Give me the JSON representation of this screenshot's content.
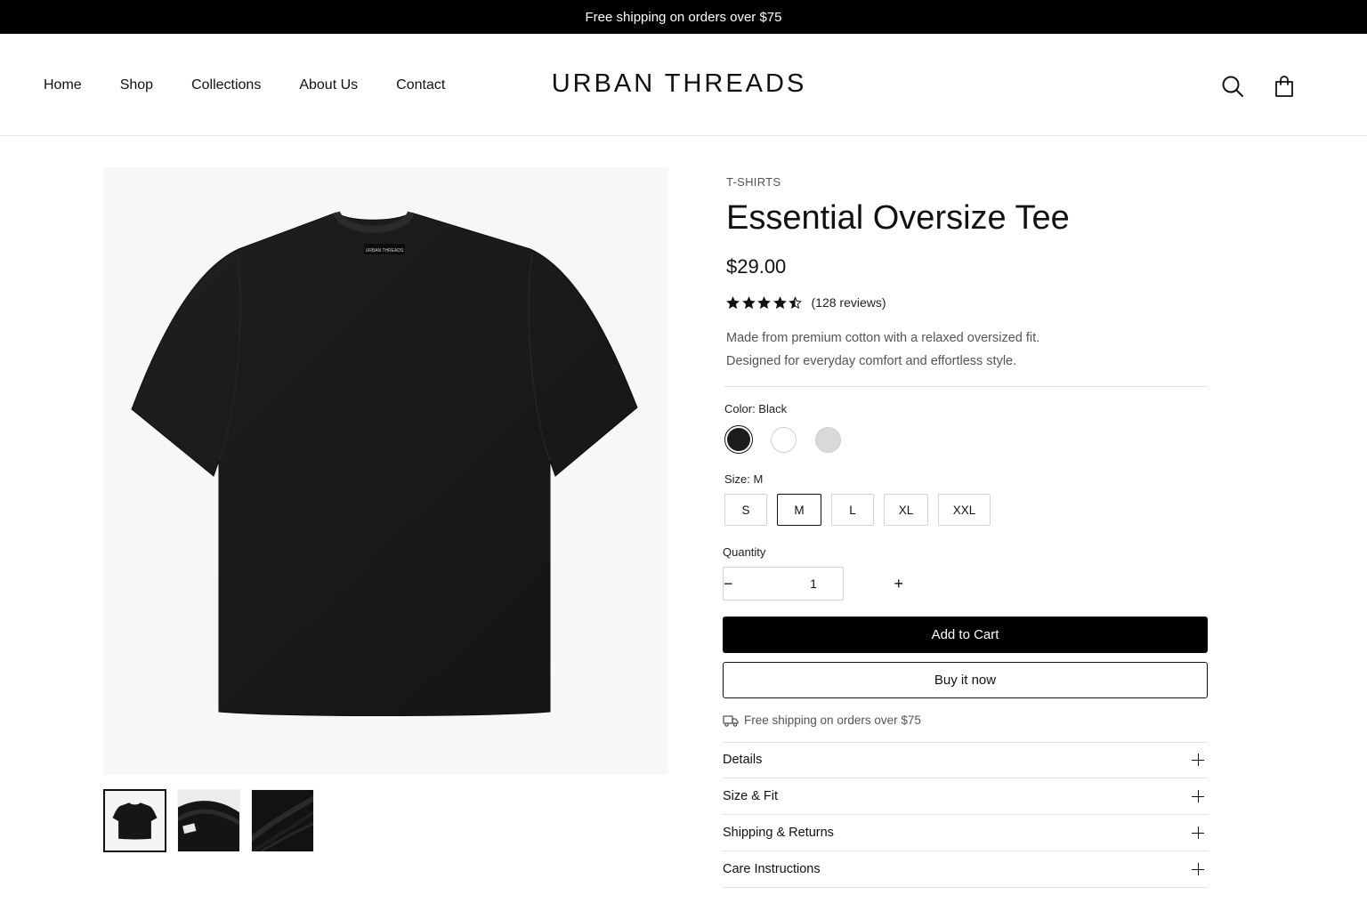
{
  "announcement": "Free shipping on orders over $75",
  "header": {
    "nav": [
      "Home",
      "Shop",
      "Collections",
      "About Us",
      "Contact"
    ],
    "logo": "URBAN THREADS",
    "icons": [
      "search-icon",
      "shopping-bag-icon"
    ]
  },
  "product": {
    "category": "T-SHIRTS",
    "title": "Essential Oversize Tee",
    "price": "$29.00",
    "rating": 4.5,
    "review_count": "(128 reviews)",
    "description": [
      "Made from premium cotton with a relaxed oversized fit.",
      "Designed for everyday comfort and effortless style."
    ],
    "color_label": "Color: Black",
    "colors": [
      {
        "name": "Black",
        "hex": "#1c1c1c",
        "selected": true
      },
      {
        "name": "White",
        "hex": "#ffffff",
        "selected": false
      },
      {
        "name": "Heather Grey",
        "hex": "#d9d9d9",
        "selected": false
      }
    ],
    "size_label": "Size: M",
    "sizes": [
      "S",
      "M",
      "L",
      "XL",
      "XXL"
    ],
    "selected_size": "M",
    "quantity_label": "Quantity",
    "quantity": "1",
    "qty_minus": "−",
    "qty_plus": "+",
    "add_to_cart": "Add to Cart",
    "buy_now": "Buy it now",
    "shipping_note": "Free shipping on orders over $75",
    "accordions": [
      "Details",
      "Size & Fit",
      "Shipping & Returns",
      "Care Instructions"
    ],
    "thumbnails": [
      "front-view",
      "collar-detail",
      "fabric-closeup"
    ],
    "tag_text": "URBAN THREADS"
  },
  "colors": {
    "accent": "#000000",
    "muted_text": "#555555",
    "border": "#d4d4d4"
  }
}
